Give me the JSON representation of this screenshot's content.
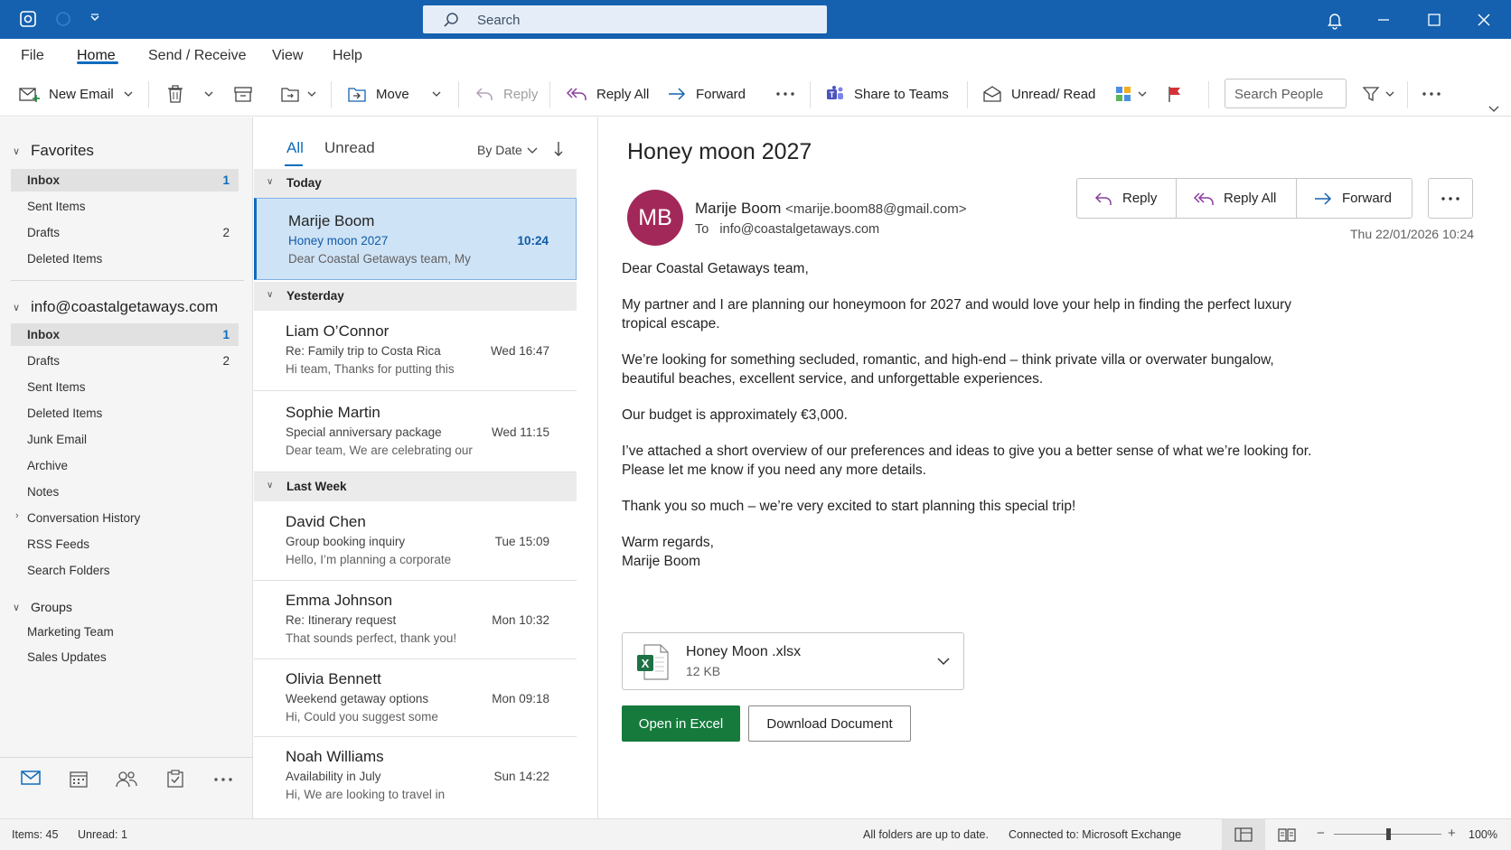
{
  "titlebar": {
    "search_placeholder": "Search"
  },
  "menu": {
    "tabs": [
      "File",
      "Home",
      "Send / Receive",
      "View",
      "Help"
    ]
  },
  "ribbon": {
    "new_email": "New Email",
    "move": "Move",
    "reply": "Reply",
    "reply_all": "Reply All",
    "forward": "Forward",
    "share_teams": "Share to Teams",
    "unread_read": "Unread/ Read",
    "search_people": "Search People"
  },
  "sidebar": {
    "favorites_label": "Favorites",
    "favorites": [
      {
        "label": "Inbox",
        "count": "1"
      },
      {
        "label": "Sent Items",
        "count": ""
      },
      {
        "label": "Drafts",
        "count": "2"
      },
      {
        "label": "Deleted Items",
        "count": ""
      }
    ],
    "account_label": "info@coastalgetaways.com",
    "account_folders": [
      {
        "label": "Inbox",
        "count": "1"
      },
      {
        "label": "Drafts",
        "count": "2"
      },
      {
        "label": "Sent Items",
        "count": ""
      },
      {
        "label": "Deleted Items",
        "count": ""
      },
      {
        "label": "Junk Email",
        "count": ""
      },
      {
        "label": "Archive",
        "count": ""
      },
      {
        "label": "Notes",
        "count": ""
      },
      {
        "label": "Conversation History",
        "count": ""
      },
      {
        "label": "RSS Feeds",
        "count": ""
      },
      {
        "label": "Search Folders",
        "count": ""
      }
    ],
    "groups_label": "Groups",
    "groups": [
      "Marketing Team",
      "Sales Updates"
    ]
  },
  "list": {
    "filter_all": "All",
    "filter_unread": "Unread",
    "sort": "By Date",
    "groups": {
      "today": "Today",
      "yesterday": "Yesterday",
      "last_week": "Last Week"
    },
    "messages": [
      {
        "from": "Marije Boom",
        "subject": "Honey moon 2027",
        "preview": "Dear Coastal Getaways team,   My",
        "time": "10:24"
      },
      {
        "from": "Liam O’Connor",
        "subject": "Re: Family trip to Costa Rica",
        "preview": "Hi team,   Thanks for putting this",
        "time": "Wed 16:47"
      },
      {
        "from": "Sophie Martin",
        "subject": "Special anniversary package",
        "preview": "Dear team,   We are celebrating our",
        "time": "Wed 11:15"
      },
      {
        "from": "David Chen",
        "subject": "Group booking inquiry",
        "preview": "Hello,   I’m planning a corporate",
        "time": "Tue 15:09"
      },
      {
        "from": "Emma Johnson",
        "subject": "Re: Itinerary request",
        "preview": "That sounds perfect, thank you!",
        "time": "Mon 10:32"
      },
      {
        "from": "Olivia Bennett",
        "subject": "Weekend getaway options",
        "preview": "Hi,   Could you suggest some",
        "time": "Mon 09:18"
      },
      {
        "from": "Noah Williams",
        "subject": "Availability in July",
        "preview": "Hi,   We are looking to travel in",
        "time": "Sun 14:22"
      }
    ]
  },
  "reading": {
    "subject": "Honey moon 2027",
    "avatar_initials": "MB",
    "sender_name": "Marije Boom",
    "sender_email": "<marije.boom88@gmail.com>",
    "to_label": "To",
    "to_address": "info@coastalgetaways.com",
    "reply": "Reply",
    "reply_all": "Reply All",
    "forward": "Forward",
    "date": "Thu 22/01/2026 10:24",
    "body": [
      "Dear Coastal Getaways team,",
      "My partner and I are planning our honeymoon for 2027 and would love your help in finding the perfect luxury tropical escape.",
      "We’re looking for something secluded, romantic, and high-end – think private villa or overwater bungalow, beautiful beaches, excellent service, and unforgettable experiences.",
      "Our budget is approximately €3,000.",
      "I’ve attached a short overview of our preferences and ideas to give you a better sense of what we’re looking for. Please let me know if you need any more details.",
      "Thank you so much – we’re very excited to start planning this special trip!"
    ],
    "signoff": "Warm regards,",
    "signature": "Marije Boom",
    "attachment_name": "Honey Moon .xlsx",
    "attachment_size": "12 KB",
    "open_excel": "Open in Excel",
    "download": "Download Document"
  },
  "status": {
    "items": "Items: 45",
    "unread": "Unread: 1",
    "sync": "All folders are up to date.",
    "connection": "Connected to: Microsoft Exchange",
    "zoom": "100%"
  },
  "colors": {
    "titlebar": "#1561b0",
    "accent": "#0f6cbd",
    "avatar": "#a3285a",
    "excel_button": "#157a3c",
    "flag": "#d13438"
  }
}
